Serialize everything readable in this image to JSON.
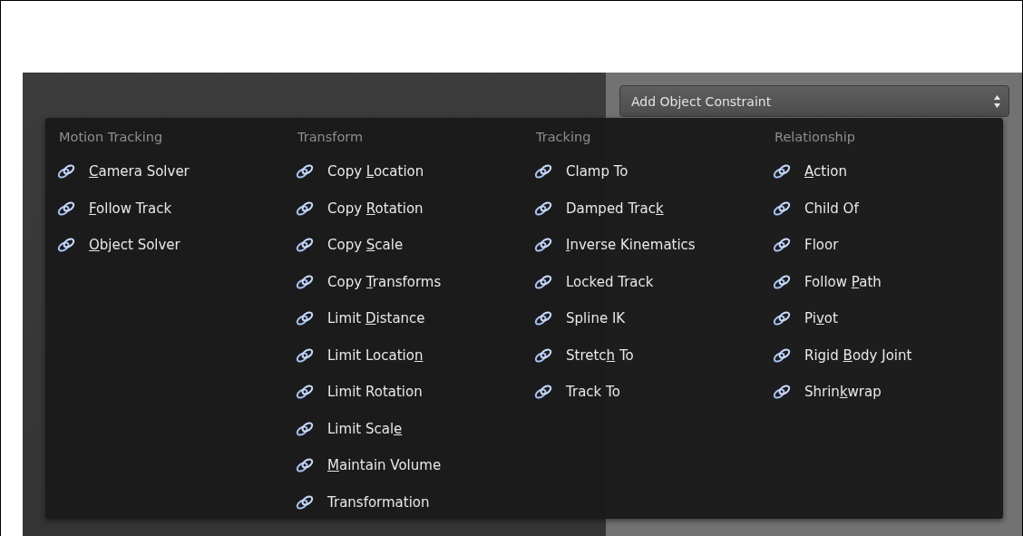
{
  "dropdown": {
    "label": "Add Object Constraint"
  },
  "menu": {
    "columns": [
      {
        "heading": "Motion Tracking",
        "items": [
          {
            "key": "C",
            "rest": "amera Solver"
          },
          {
            "key": "F",
            "rest": "ollow Track"
          },
          {
            "key": "O",
            "rest": "bject Solver"
          }
        ]
      },
      {
        "heading": "Transform",
        "items": [
          {
            "text": "Copy ",
            "key": "L",
            "rest": "ocation"
          },
          {
            "text": "Copy ",
            "key": "R",
            "rest": "otation"
          },
          {
            "text": "Copy ",
            "key": "S",
            "rest": "cale"
          },
          {
            "text": "Copy ",
            "key": "T",
            "rest": "ransforms"
          },
          {
            "text": "Limit ",
            "key": "D",
            "rest": "istance"
          },
          {
            "text": "Limit Locatio",
            "key": "n"
          },
          {
            "text": "Limit Rotation"
          },
          {
            "text": "Limit Scal",
            "key": "e"
          },
          {
            "key": "M",
            "rest": "aintain Volume"
          },
          {
            "text": "Transformation"
          }
        ]
      },
      {
        "heading": "Tracking",
        "items": [
          {
            "text": "Clamp To"
          },
          {
            "text": "Damped Trac",
            "key": "k"
          },
          {
            "key": "I",
            "rest": "nverse Kinematics"
          },
          {
            "text": "Locked Track"
          },
          {
            "text": "Spline IK"
          },
          {
            "text": "Stretc",
            "key": "h",
            "rest": " To"
          },
          {
            "text": "Track To"
          }
        ]
      },
      {
        "heading": "Relationship",
        "items": [
          {
            "key": "A",
            "rest": "ction"
          },
          {
            "text": "Child Of"
          },
          {
            "text": "Floor"
          },
          {
            "text": "Follow ",
            "key": "P",
            "rest": "ath"
          },
          {
            "text": "Pi",
            "key": "v",
            "rest": "ot"
          },
          {
            "text": "Rigid ",
            "key": "B",
            "rest": "ody Joint"
          },
          {
            "text": "Shrin",
            "key": "k",
            "rest": "wrap"
          }
        ]
      }
    ]
  }
}
